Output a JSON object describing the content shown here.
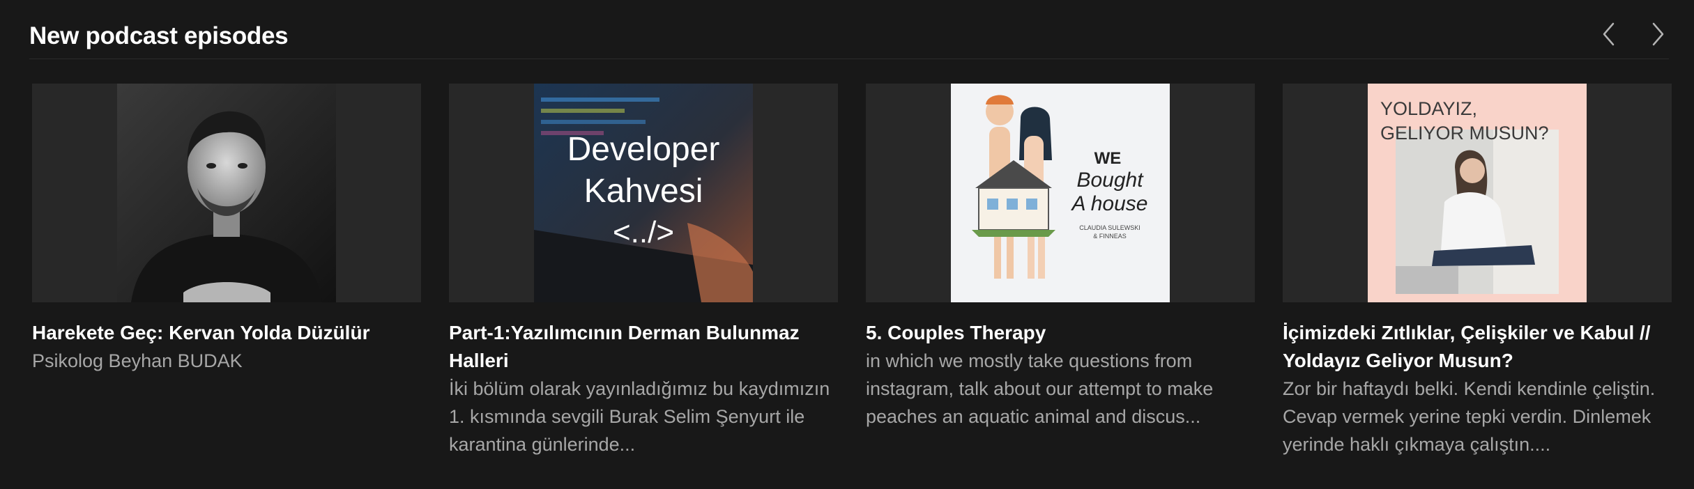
{
  "shelf": {
    "title": "New podcast episodes",
    "prev_icon": "chevron-left-icon",
    "next_icon": "chevron-right-icon"
  },
  "episodes": [
    {
      "title": "Harekete Geç: Kervan Yolda Düzülür",
      "description": "Psikolog Beyhan BUDAK",
      "art": {
        "icon": "portrait-photo"
      }
    },
    {
      "title": "Part-1:Yazılımcının Derman Bulunmaz Halleri",
      "description": "İki bölüm olarak yayınladığımız bu kaydımızın 1. kısmında sevgili Burak Selim Şenyurt ile karantina günlerinde...",
      "art": {
        "line1": "Developer",
        "line2": "Kahvesi",
        "line3": "<../>"
      }
    },
    {
      "title": "5. Couples Therapy",
      "description": "in which we mostly take questions from instagram, talk about our attempt to make peaches an aquatic animal and discus...",
      "art": {
        "line1": "WE",
        "line2": "Bought",
        "line3": "A house",
        "line4": "CLAUDIA SULEWSKI",
        "line5": "& FINNEAS"
      }
    },
    {
      "title": "İçimizdeki Zıtlıklar, Çelişkiler ve Kabul // Yoldayız Geliyor Musun?",
      "description": "Zor bir haftaydı belki. Kendi kendinle çeliştin. Cevap vermek yerine tepki verdin. Dinlemek yerinde haklı çıkmaya çalıştın....",
      "art": {
        "line1": "YOLDAYIZ,",
        "line2": "GELIYOR MUSUN?"
      }
    }
  ],
  "colors": {
    "background": "#181818",
    "card_art_bg": "#282828",
    "title": "#ffffff",
    "subtext": "#a7a7a7"
  }
}
